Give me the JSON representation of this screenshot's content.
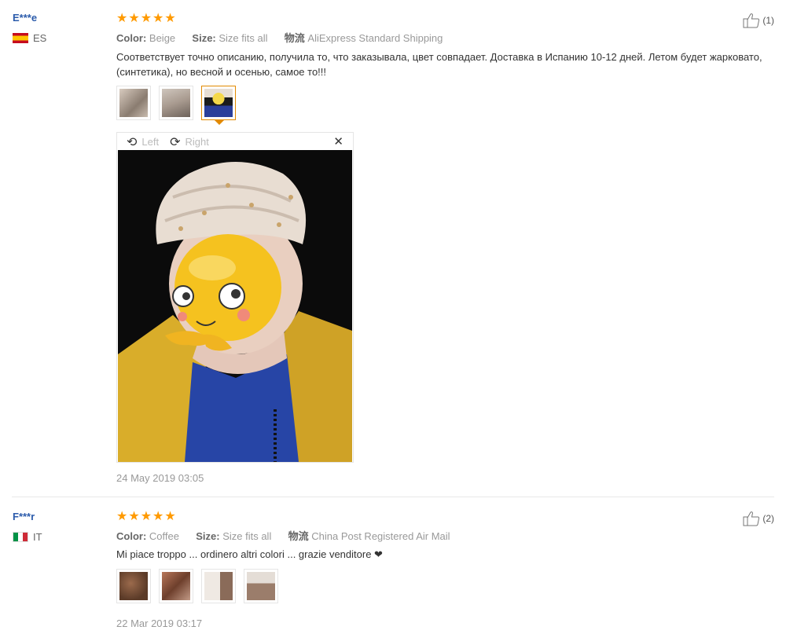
{
  "reviews": [
    {
      "user": "E***e",
      "country": "ES",
      "stars": 5,
      "color_label": "Color:",
      "color_value": "Beige",
      "size_label": "Size:",
      "size_value": "Size fits all",
      "shipping_label": "物流",
      "shipping_value": "AliExpress Standard Shipping",
      "text": "Соответствует точно описанию, получила то, что заказывала, цвет совпадает. Доставка в Испанию 10-12 дней. Летом будет жарковато, (синтетика), но весной и осенью, самое то!!!",
      "thumbnails": [
        "photo-1",
        "photo-2",
        "photo-3"
      ],
      "viewer": {
        "rotate_left": "Left",
        "rotate_right": "Right"
      },
      "date": "24 May 2019 03:05",
      "helpful_count": "(1)"
    },
    {
      "user": "F***r",
      "country": "IT",
      "stars": 5,
      "color_label": "Color:",
      "color_value": "Coffee",
      "size_label": "Size:",
      "size_value": "Size fits all",
      "shipping_label": "物流",
      "shipping_value": "China Post Registered Air Mail",
      "text": "Mi piace troppo ... ordinero altri colori ... grazie venditore ❤",
      "thumbnails": [
        "photo-1",
        "photo-2",
        "photo-3",
        "photo-4"
      ],
      "date": "22 Mar 2019 03:17",
      "helpful_count": "(2)"
    }
  ],
  "colors": {
    "star": "#ff9a00",
    "username": "#2b5bab",
    "active_border": "#e28a00"
  },
  "icons": {
    "rating": "star-icon",
    "helpful": "thumbs-up-icon",
    "rotate_left": "rotate-left-icon",
    "rotate_right": "rotate-right-icon",
    "close": "close-icon"
  }
}
